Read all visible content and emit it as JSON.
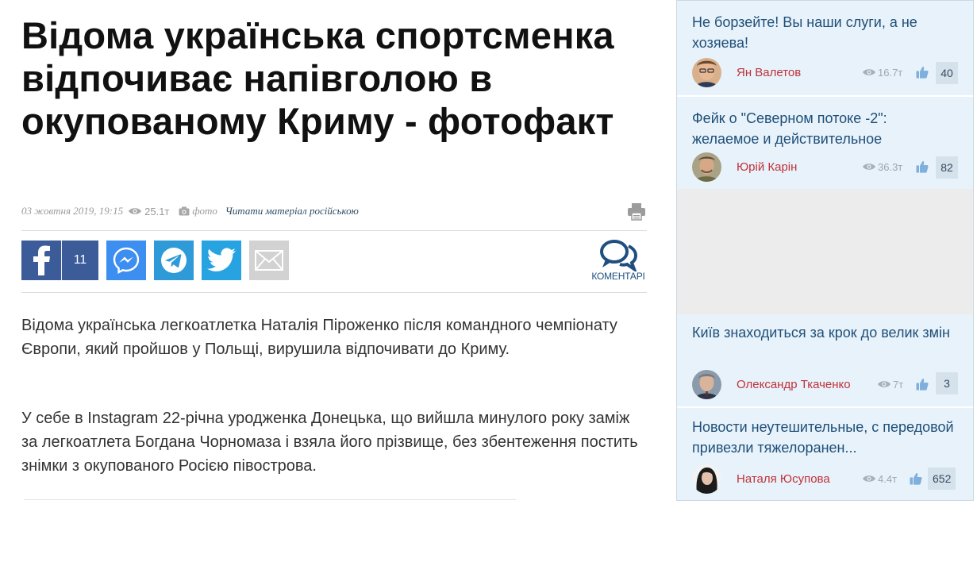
{
  "article": {
    "title": "Відома українська спортсменка відпочиває напівголою в окупованому Криму - фотофакт",
    "date": "03 жовтня 2019, 19:15",
    "views": "25.1т",
    "photo_label": "фото",
    "read_in_russian": "Читати матеріал російською",
    "facebook_count": "11",
    "comments_label": "КОМЕНТАРІ",
    "paragraphs": [
      "Відома українська легкоатлетка Наталія Піроженко після командного чемпіонату Європи, який пройшов у Польщі, вирушила відпочивати до Криму.",
      "У себе в Instagram 22-річна уродженка Донецька, що вийшла минулого року заміж за легкоатлета Богдана Чорномаза і взяла його прізвище, без збентеження постить знімки з окупованого Росією півострова."
    ]
  },
  "sidebar": {
    "items": [
      {
        "headline": "Не борзейте! Вы наши слуги, а не хозяева!",
        "author": "Ян Валетов",
        "views": "16.7т",
        "likes": "40"
      },
      {
        "headline": "Фейк о \"Северном потоке -2\": желаемое и действительное",
        "author": "Юрій Карін",
        "views": "36.3т",
        "likes": "82"
      },
      {
        "headline": "Київ знаходиться за крок до велик змін",
        "author": "Олександр Ткаченко",
        "views": "7т",
        "likes": "3"
      },
      {
        "headline": "Новости неутешительные, с передовой привезли тяжелоранен...",
        "author": "Наталя Юсупова",
        "views": "4.4т",
        "likes": "652"
      }
    ]
  },
  "colors": {
    "facebook": "#3b5b99",
    "messenger": "#3c8ef0",
    "telegram": "#2e9bd8",
    "twitter": "#28a3e2",
    "email": "#d2d2d2",
    "sidebar_bg": "#e8f2fa",
    "headline_link": "#1e4f78",
    "author_red": "#c0313a"
  }
}
